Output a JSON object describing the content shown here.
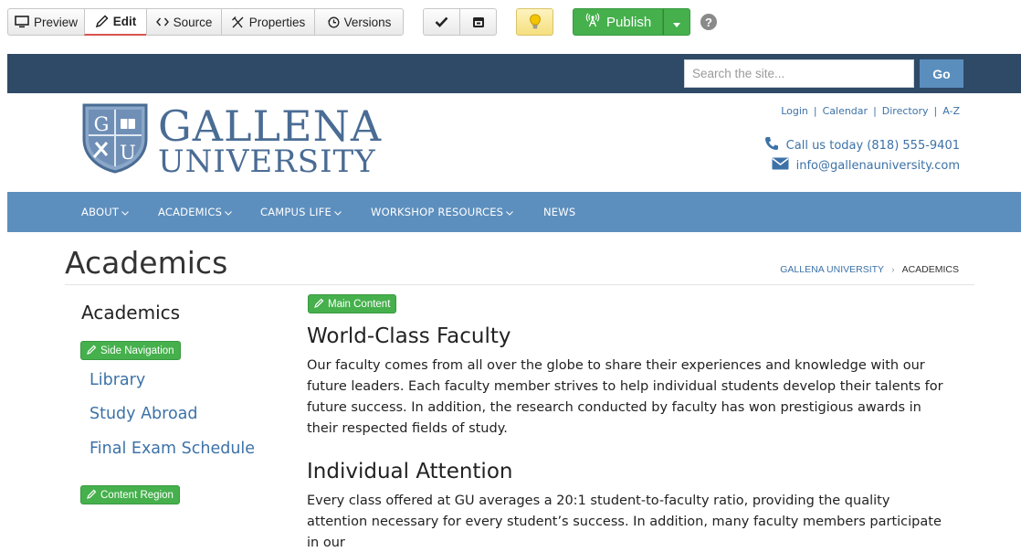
{
  "toolbar": {
    "buttons": [
      {
        "label": "Preview",
        "icon": "monitor-icon"
      },
      {
        "label": "Edit",
        "icon": "pencil-icon"
      },
      {
        "label": "Source",
        "icon": "code-icon"
      },
      {
        "label": "Properties",
        "icon": "tools-icon"
      },
      {
        "label": "Versions",
        "icon": "history-icon"
      }
    ],
    "publish_label": "Publish",
    "help_glyph": "?"
  },
  "topbar": {
    "search_placeholder": "Search the site...",
    "go_label": "Go",
    "color": "#2f4a66"
  },
  "header": {
    "shield_letters": [
      "G",
      "U"
    ],
    "logo_line1": "GALLENA",
    "logo_line2": "UNIVERSITY",
    "utility_links": [
      "Login",
      "Calendar",
      "Directory",
      "A-Z"
    ],
    "phone": "Call us today (818) 555-9401",
    "email": "info@gallenauniversity.com"
  },
  "nav": {
    "items": [
      "ABOUT",
      "ACADEMICS",
      "CAMPUS LIFE",
      "WORKSHOP RESOURCES",
      "NEWS"
    ],
    "color": "#5d8fbe"
  },
  "page": {
    "title": "Academics",
    "breadcrumb": {
      "link": "GALLENA UNIVERSITY",
      "sep": "›",
      "current": "ACADEMICS"
    }
  },
  "sidebar": {
    "title": "Academics",
    "side_nav_tag": "Side Navigation",
    "links": [
      "Library",
      "Study Abroad",
      "Final Exam Schedule"
    ],
    "content_region_tag": "Content Region"
  },
  "main": {
    "tag": "Main Content",
    "sections": [
      {
        "heading": "World-Class Faculty",
        "body": "Our faculty comes from all over the globe to share their experiences and knowledge with our future leaders. Each faculty member strives to help individual students develop their talents for future success. In addition, the research conducted by faculty has won prestigious awards in their respected fields of study."
      },
      {
        "heading": "Individual Attention",
        "body": "Every class offered at GU averages a 20:1 student-to-faculty ratio, providing the quality attention necessary for every student’s success. In addition, many faculty members participate in our"
      }
    ]
  },
  "colors": {
    "accent_green": "#45b04c",
    "link_blue": "#3c72a8",
    "logo_blue": "#4a6c94"
  }
}
